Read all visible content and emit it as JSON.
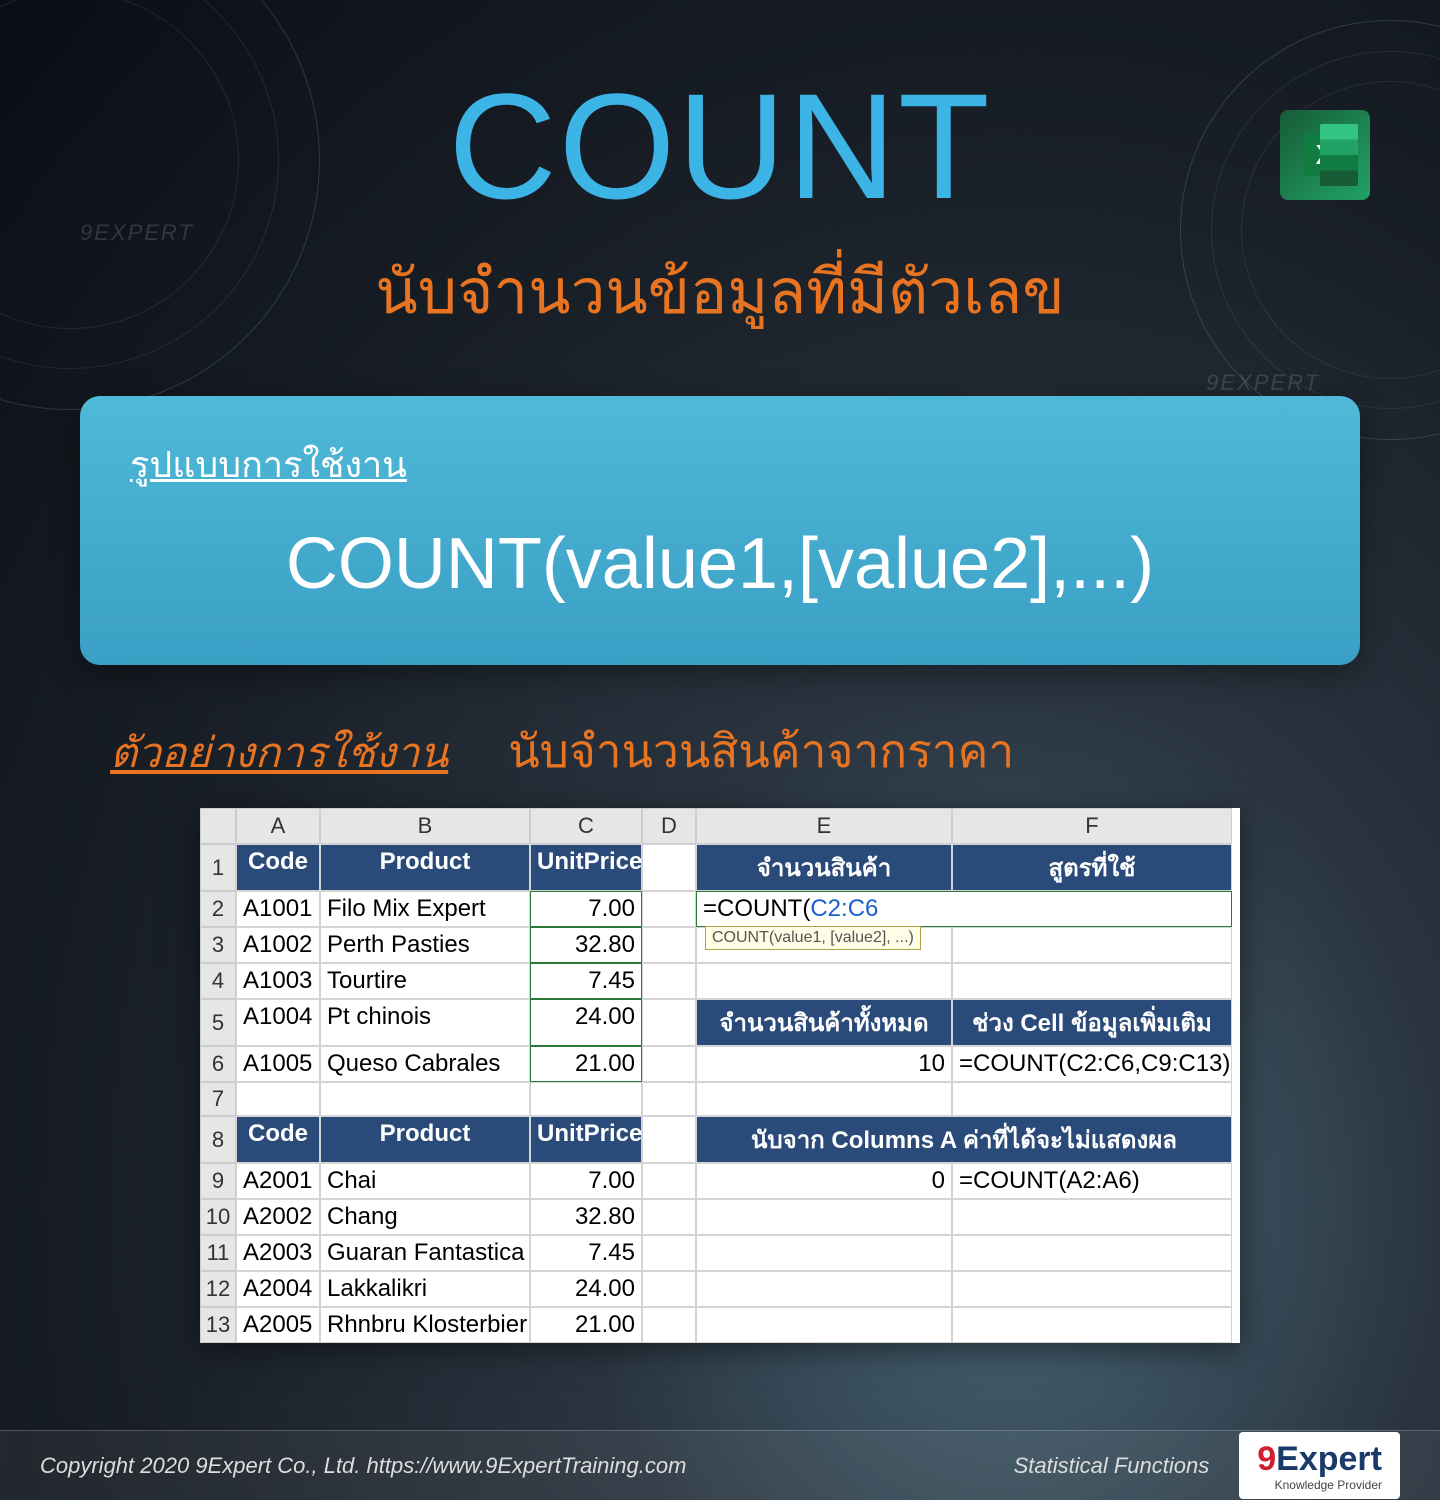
{
  "watermarks": {
    "w1": "9EXPERT",
    "w2": "9EXPERT"
  },
  "icon": {
    "letter": "X"
  },
  "title": "COUNT",
  "subtitle": "นับจำนวนข้อมูลที่มีตัวเลข",
  "syntax": {
    "label": "รูปแบบการใช้งาน",
    "text": "COUNT(value1,[value2],...)"
  },
  "example": {
    "label": "ตัวอย่างการใช้งาน",
    "desc": "นับจำนวนสินค้าจากราคา"
  },
  "sheet": {
    "cols": [
      "A",
      "B",
      "C",
      "D",
      "E",
      "F"
    ],
    "headers1": {
      "code": "Code",
      "product": "Product",
      "price": "UnitPrice"
    },
    "rows1": [
      {
        "n": "1"
      },
      {
        "n": "2",
        "code": "A1001",
        "product": "Filo Mix Expert",
        "price": "7.00"
      },
      {
        "n": "3",
        "code": "A1002",
        "product": "Perth Pasties",
        "price": "32.80"
      },
      {
        "n": "4",
        "code": "A1003",
        "product": "Tourtire",
        "price": "7.45"
      },
      {
        "n": "5",
        "code": "A1004",
        "product": "Pt chinois",
        "price": "24.00"
      },
      {
        "n": "6",
        "code": "A1005",
        "product": "Queso Cabrales",
        "price": "21.00"
      },
      {
        "n": "7"
      }
    ],
    "headers2": {
      "code": "Code",
      "product": "Product",
      "price": "UnitPrice"
    },
    "rows2": [
      {
        "n": "8"
      },
      {
        "n": "9",
        "code": "A2001",
        "product": "Chai",
        "price": "7.00"
      },
      {
        "n": "10",
        "code": "A2002",
        "product": "Chang",
        "price": "32.80"
      },
      {
        "n": "11",
        "code": "A2003",
        "product": "Guaran Fantastica",
        "price": "7.45"
      },
      {
        "n": "12",
        "code": "A2004",
        "product": "Lakkalikri",
        "price": "24.00"
      },
      {
        "n": "13",
        "code": "A2005",
        "product": "Rhnbru Klosterbier",
        "price": "21.00"
      }
    ],
    "panelE": {
      "h1e": "จำนวนสินค้า",
      "h1f": "สูตรที่ใช้",
      "formula_text_pre": "=COUNT(",
      "formula_ref": "C2:C6",
      "tooltip": "COUNT(value1, [value2], ...)",
      "h2e": "จำนวนสินค้าทั้งหมด",
      "h2f": "ช่วง Cell ข้อมูลเพิ่มเติม",
      "v2e": "10",
      "v2f": "=COUNT(C2:C6,C9:C13)",
      "h3": "นับจาก Columns A ค่าที่ได้จะไม่แสดงผล",
      "v3e": "0",
      "v3f": "=COUNT(A2:A6)"
    }
  },
  "footer": {
    "copyright": "Copyright 2020 9Expert Co., Ltd.   https://www.9ExpertTraining.com",
    "category": "Statistical Functions",
    "logo_nine": "9",
    "logo_expert": "Expert",
    "logo_tag": "Knowledge Provider"
  }
}
